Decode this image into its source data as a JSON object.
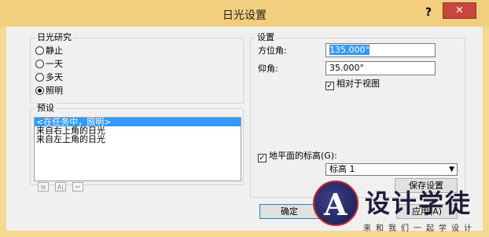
{
  "window": {
    "title": "日光设置",
    "help_label": "?",
    "close_label": "✕"
  },
  "sun_study": {
    "legend": "日光研究",
    "options": [
      {
        "label": "静止",
        "selected": false
      },
      {
        "label": "一天",
        "selected": false
      },
      {
        "label": "多天",
        "selected": false
      },
      {
        "label": "照明",
        "selected": true
      }
    ]
  },
  "presets": {
    "legend": "预设",
    "items": [
      {
        "label": "<在任务中，照明>",
        "selected": true
      },
      {
        "label": "来自右上角的日光",
        "selected": false
      },
      {
        "label": "来自左上角的日光",
        "selected": false
      }
    ],
    "tool_icons": [
      "duplicate-icon",
      "rename-icon",
      "delete-icon"
    ],
    "tool_glyphs": [
      "⧉",
      "A|",
      "✂"
    ]
  },
  "settings": {
    "legend": "设置",
    "azimuth_label": "方位角:",
    "azimuth_value": "135.000°",
    "altitude_label": "仰角:",
    "altitude_value": "35.000°",
    "relative_to_view_label": "相对于视图",
    "relative_to_view_checked": true,
    "ground_plane_label": "地平面的标高(G):",
    "ground_plane_checked": true,
    "level_value": "标高 1",
    "save_button": "保存设置"
  },
  "footer": {
    "ok_label": "确定",
    "apply_label": "应用(A)"
  },
  "watermark": {
    "brand": "设计学徒",
    "tagline": "来和我们一起学设计"
  },
  "colors": {
    "title_bar": "#f1cf7e",
    "close": "#c7463d",
    "selection": "#3399ff"
  }
}
